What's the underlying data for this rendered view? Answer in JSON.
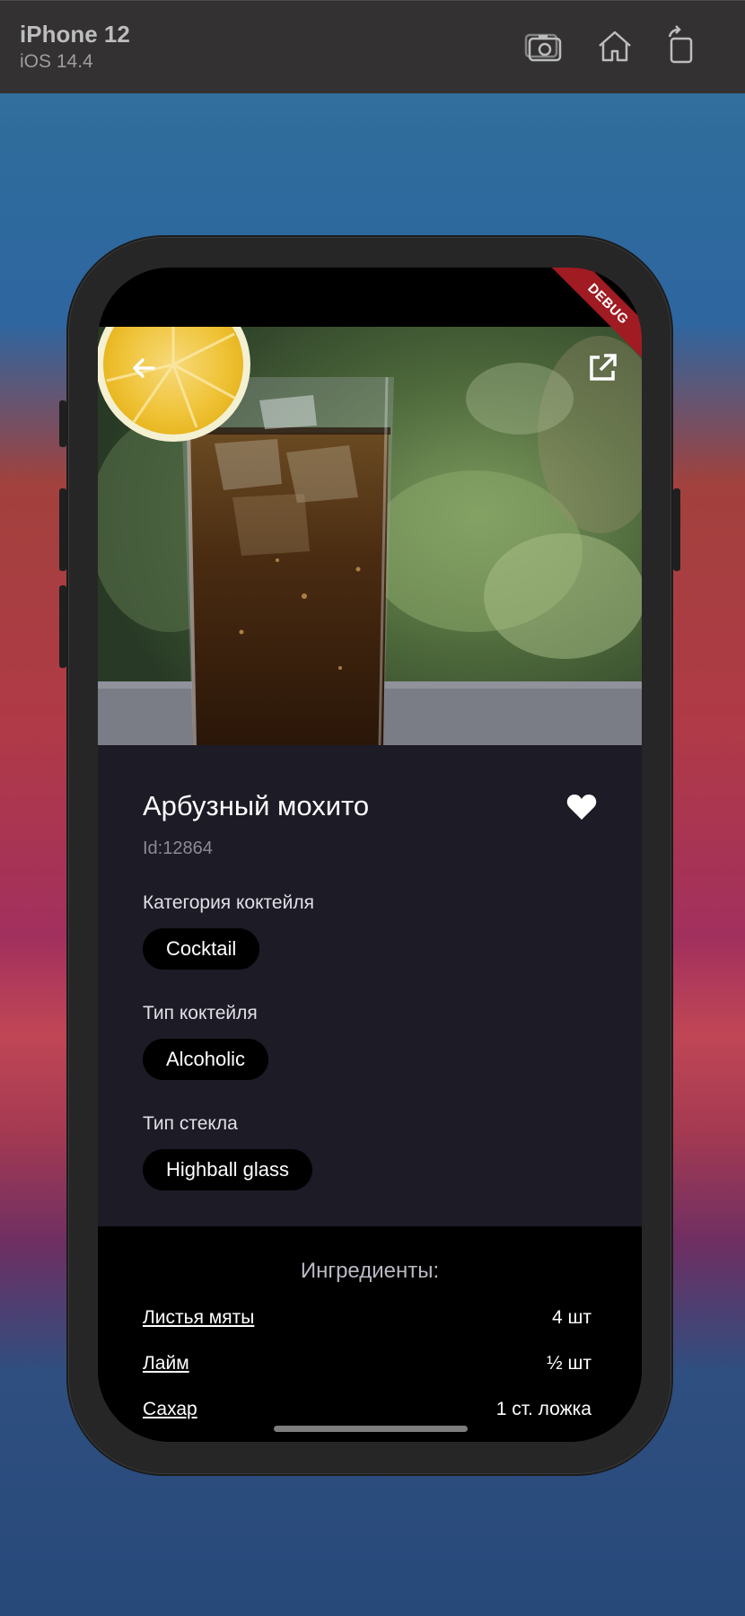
{
  "simulator": {
    "device": "iPhone 12",
    "os": "iOS 14.4",
    "icons": [
      "screenshot-icon",
      "home-icon",
      "rotate-icon"
    ]
  },
  "app": {
    "debug_banner": "DEBUG",
    "drink": {
      "name": "Арбузный мохито",
      "id_text": "Id:12864",
      "favorite": true
    },
    "sections": [
      {
        "label": "Категория коктейля",
        "value": "Cocktail"
      },
      {
        "label": "Тип коктейля",
        "value": "Alcoholic"
      },
      {
        "label": "Тип стекла",
        "value": "Highball glass"
      }
    ],
    "ingredients": {
      "title": "Ингредиенты:",
      "items": [
        {
          "name": "Листья мяты",
          "qty": "4 шт"
        },
        {
          "name": "Лайм",
          "qty": "½ шт"
        },
        {
          "name": "Сахар",
          "qty": "1 ст. ложка"
        }
      ]
    }
  },
  "colors": {
    "info_bg": "#1c1b26",
    "chip_bg": "#000000",
    "debug_red": "#a01b22"
  }
}
